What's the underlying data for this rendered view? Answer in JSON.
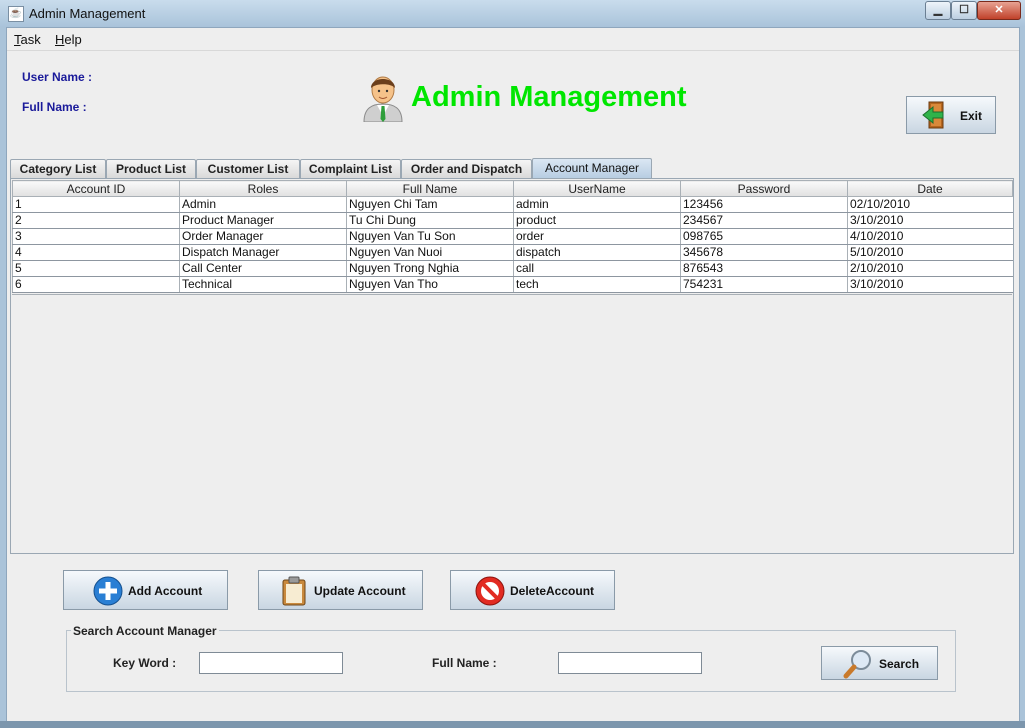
{
  "window": {
    "title": "Admin Management",
    "app_icon": "java-icon"
  },
  "window_controls": {
    "minimize": "▁",
    "maximize": "☐",
    "close": "✕"
  },
  "menu": {
    "items": [
      {
        "label": "Task",
        "mnemonic": "T",
        "rest": "ask"
      },
      {
        "label": "Help",
        "mnemonic": "H",
        "rest": "elp"
      }
    ]
  },
  "header": {
    "user_name_label": "User Name :",
    "full_name_label": "Full Name :",
    "title": "Admin Management",
    "title_color": "#00e600",
    "exit_label": "Exit"
  },
  "tabs": [
    {
      "label": "Category List",
      "active": false
    },
    {
      "label": "Product List",
      "active": false
    },
    {
      "label": "Customer List",
      "active": false
    },
    {
      "label": "Complaint List",
      "active": false
    },
    {
      "label": "Order and Dispatch",
      "active": false
    },
    {
      "label": "Account Manager",
      "active": true
    }
  ],
  "table": {
    "columns": [
      "Account ID",
      "Roles",
      "Full Name",
      "UserName",
      "Password",
      "Date"
    ],
    "rows": [
      [
        "1",
        "Admin",
        "Nguyen Chi Tam",
        "admin",
        "123456",
        "02/10/2010"
      ],
      [
        "2",
        "Product Manager",
        "Tu Chi Dung",
        "product",
        "234567",
        "3/10/2010"
      ],
      [
        "3",
        "Order Manager",
        "Nguyen Van Tu Son",
        "order",
        "098765",
        "4/10/2010"
      ],
      [
        "4",
        "Dispatch Manager",
        "Nguyen Van Nuoi",
        "dispatch",
        "345678",
        "5/10/2010"
      ],
      [
        "5",
        "Call Center",
        "Nguyen Trong Nghia",
        "call",
        "876543",
        "2/10/2010"
      ],
      [
        "6",
        "Technical",
        "Nguyen Van Tho",
        "tech",
        "754231",
        "3/10/2010"
      ]
    ]
  },
  "actions": {
    "add_label": "Add Account",
    "update_label": "Update Account",
    "delete_label": "DeleteAccount"
  },
  "search": {
    "group_title": "Search Account Manager",
    "keyword_label": "Key Word :",
    "keyword_value": "",
    "fullname_label": "Full Name :",
    "fullname_value": "",
    "button_label": "Search"
  }
}
